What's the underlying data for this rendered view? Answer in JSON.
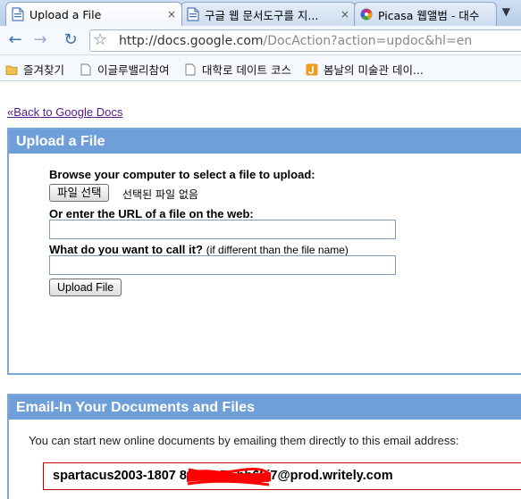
{
  "browser": {
    "tabs": [
      {
        "title": "Upload a File",
        "close": "×",
        "active": true
      },
      {
        "title": "구글 웹 문서도구를 지...",
        "close": "×",
        "active": false
      },
      {
        "title": "Picasa 웹앨범 - 대수",
        "close": "",
        "active": false
      }
    ],
    "tab_menu": "▼",
    "nav": {
      "back": "←",
      "forward": "→",
      "reload": "↻",
      "star": "☆"
    },
    "url": {
      "host": "http://docs.google.com",
      "path": "/DocAction?action=updoc&hl=en"
    },
    "bookmarks": [
      "즐겨찾기",
      "이글루밸리참여",
      "대학로 데이트 코스",
      "봄날의 미술관 데이..."
    ]
  },
  "page": {
    "back_link": "«Back to Google Docs",
    "upload": {
      "header": "Upload a File",
      "browse_label": "Browse your computer to select a file to upload:",
      "choose_button": "파일 선택",
      "no_file_text": "선택된 파일 없음",
      "url_label": "Or enter the URL of a file on the web:",
      "url_value": "",
      "name_label": "What do you want to call it?",
      "name_hint": "(if different than the file name)",
      "name_value": "",
      "upload_button": "Upload File"
    },
    "email": {
      "header": "Email-In Your Documents and Files",
      "description": "You can start new online documents by emailing them directly to this email address:",
      "address_visible": "spartacus2003-1807                    81633-B5hb65j7@prod.writely.com"
    }
  },
  "colors": {
    "panel_header": "#6f9fd8",
    "panel_border": "#7aa7d7",
    "visited_link": "#551a8b",
    "email_box_border": "#c00000",
    "redaction": "#ff0000"
  }
}
